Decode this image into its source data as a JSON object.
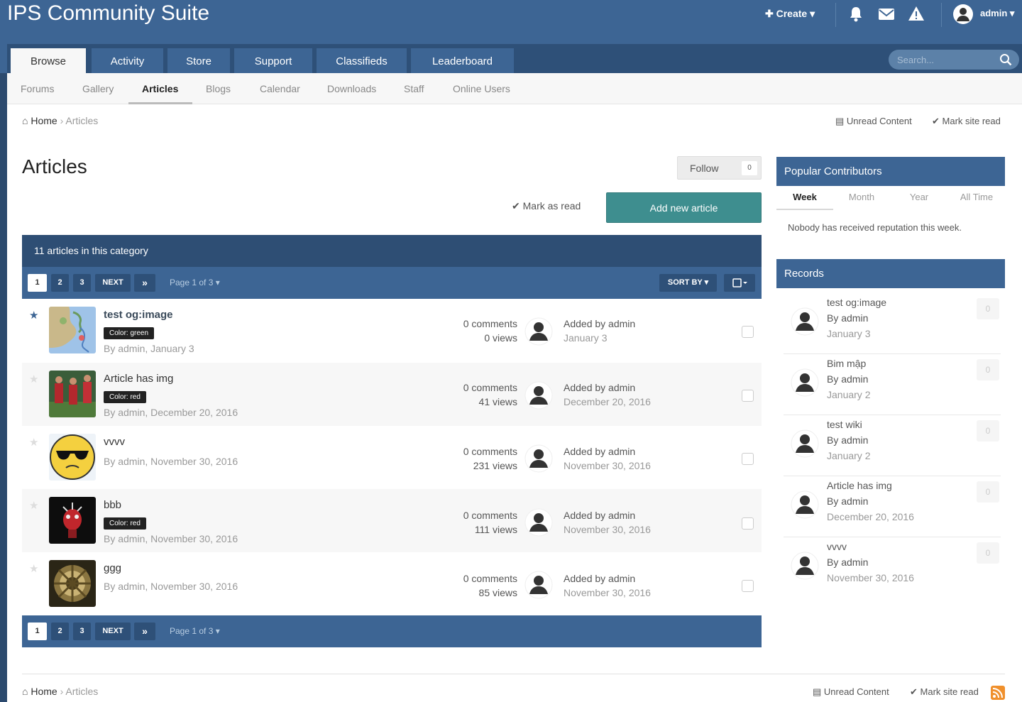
{
  "header": {
    "site_title": "IPS Community Suite",
    "create_label": "Create",
    "user_label": "admin",
    "icons": [
      "bell-icon",
      "envelope-icon",
      "warning-icon",
      "avatar"
    ]
  },
  "main_nav": {
    "tabs": [
      {
        "label": "Browse",
        "active": true
      },
      {
        "label": "Activity"
      },
      {
        "label": "Store"
      },
      {
        "label": "Support"
      },
      {
        "label": "Classifieds"
      },
      {
        "label": "Leaderboard"
      }
    ],
    "search_placeholder": "Search..."
  },
  "sub_nav": {
    "items": [
      {
        "label": "Forums"
      },
      {
        "label": "Gallery"
      },
      {
        "label": "Articles",
        "active": true
      },
      {
        "label": "Blogs"
      },
      {
        "label": "Calendar"
      },
      {
        "label": "Downloads"
      },
      {
        "label": "Staff"
      },
      {
        "label": "Online Users"
      }
    ]
  },
  "breadcrumb": {
    "home": "Home",
    "current": "Articles"
  },
  "top_actions": {
    "unread": "Unread Content",
    "mark_site_read": "Mark site read"
  },
  "page": {
    "title": "Articles",
    "follow_label": "Follow",
    "follow_count": "0",
    "mark_as_read": "Mark as read",
    "add_new": "Add new article"
  },
  "list": {
    "count_text": "11 articles in this category",
    "pagination": {
      "pages": [
        "1",
        "2",
        "3"
      ],
      "next": "NEXT",
      "last": "»",
      "page_info": "Page 1 of 3"
    },
    "sort_label": "SORT BY",
    "rows": [
      {
        "title": "test og:image",
        "featured": true,
        "badge": "Color: green",
        "meta": "By admin, January 3",
        "comments": "0 comments",
        "views": "0 views",
        "added_by": "Added by admin",
        "added_date": "January 3"
      },
      {
        "title": "Article has img",
        "featured": false,
        "badge": "Color: red",
        "meta": "By admin, December 20, 2016",
        "comments": "0 comments",
        "views": "41 views",
        "added_by": "Added by admin",
        "added_date": "December 20, 2016"
      },
      {
        "title": "vvvv",
        "featured": false,
        "badge": "",
        "meta": "By admin, November 30, 2016",
        "comments": "0 comments",
        "views": "231 views",
        "added_by": "Added by admin",
        "added_date": "November 30, 2016"
      },
      {
        "title": "bbb",
        "featured": false,
        "badge": "Color: red",
        "meta": "By admin, November 30, 2016",
        "comments": "0 comments",
        "views": "111 views",
        "added_by": "Added by admin",
        "added_date": "November 30, 2016"
      },
      {
        "title": "ggg",
        "featured": false,
        "badge": "",
        "meta": "By admin, November 30, 2016",
        "comments": "0 comments",
        "views": "85 views",
        "added_by": "Added by admin",
        "added_date": "November 30, 2016"
      }
    ]
  },
  "sidebar": {
    "popular": {
      "title": "Popular Contributors",
      "tabs": [
        {
          "label": "Week",
          "active": true
        },
        {
          "label": "Month"
        },
        {
          "label": "Year"
        },
        {
          "label": "All Time"
        }
      ],
      "empty": "Nobody has received reputation this week."
    },
    "records": {
      "title": "Records",
      "items": [
        {
          "title": "test og:image",
          "by": "By admin",
          "date": "January 3",
          "count": "0"
        },
        {
          "title": "Bim mập",
          "by": "By admin",
          "date": "January 2",
          "count": "0"
        },
        {
          "title": "test wiki",
          "by": "By admin",
          "date": "January 2",
          "count": "0"
        },
        {
          "title": "Article has img",
          "by": "By admin",
          "date": "December 20, 2016",
          "count": "0"
        },
        {
          "title": "vvvv",
          "by": "By admin",
          "date": "November 30, 2016",
          "count": "0"
        }
      ]
    }
  },
  "footer": {
    "home": "Home",
    "current": "Articles",
    "unread": "Unread Content",
    "mark_site_read": "Mark site read"
  },
  "colors": {
    "primary": "#3d6594",
    "dark": "#2e4e74",
    "teal": "#3e8e8f"
  }
}
